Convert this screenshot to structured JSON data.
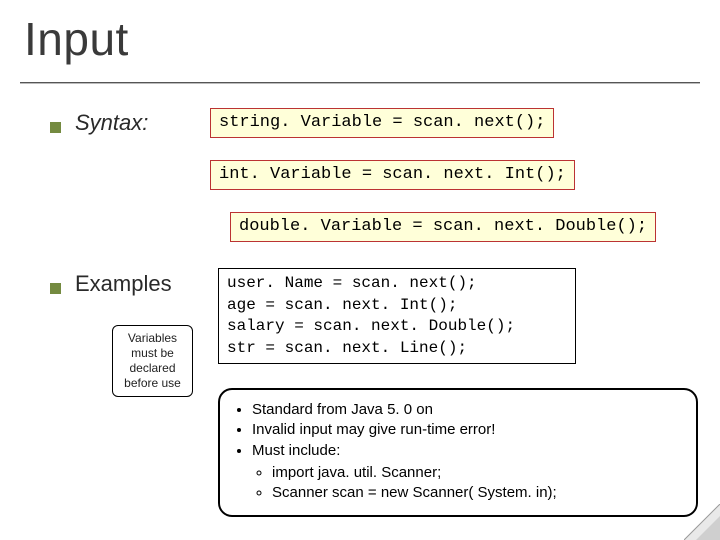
{
  "title": "Input",
  "bullets": {
    "syntax_label": "Syntax:",
    "examples_label": "Examples"
  },
  "syntax": {
    "box1": "string. Variable = scan. next();",
    "box2": "int. Variable = scan. next. Int();",
    "box3": "double. Variable = scan. next. Double();"
  },
  "examples_code": "user. Name = scan. next();\nage = scan. next. Int();\nsalary = scan. next. Double();\nstr = scan. next. Line();",
  "callout_text": "Variables\nmust be\ndeclared\nbefore use",
  "notes": {
    "i1": "Standard from Java 5. 0 on",
    "i2": "Invalid input may give run-time error!",
    "i3": "Must include:",
    "s1": "import java. util. Scanner;",
    "s2": "Scanner scan = new Scanner( System. in);"
  }
}
